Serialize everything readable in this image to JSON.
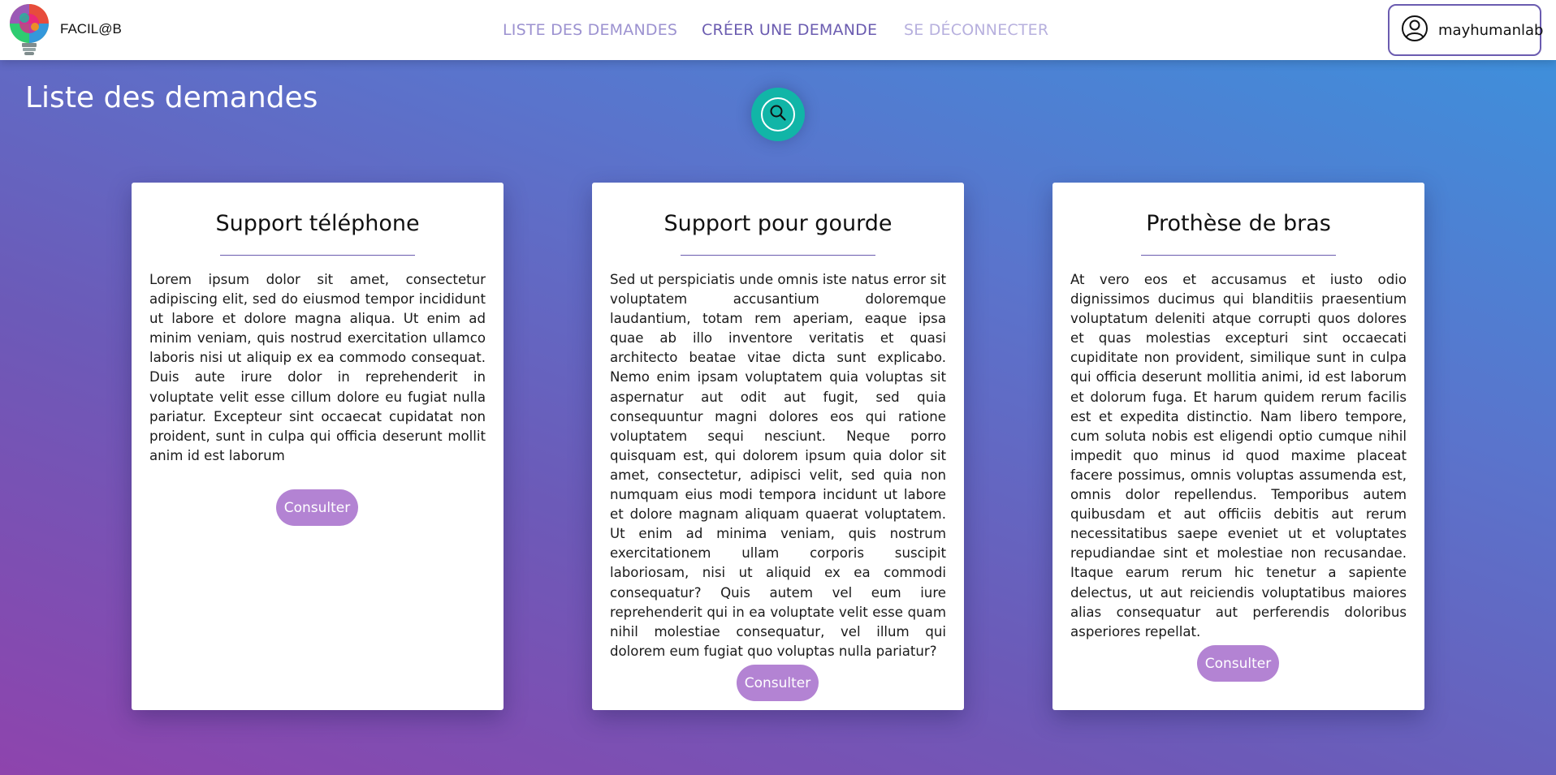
{
  "header": {
    "brand": "FACIL@B",
    "nav": [
      {
        "label": "LISTE DES DEMANDES"
      },
      {
        "label": "CRÉER UNE DEMANDE"
      },
      {
        "label": "SE DÉCONNECTER"
      }
    ],
    "user": {
      "name": "mayhumanlab",
      "icon": "user-circle-icon"
    }
  },
  "main": {
    "title": "Liste des demandes",
    "search_icon": "search-icon",
    "cards": [
      {
        "title": "Support téléphone",
        "text": "Lorem ipsum dolor sit amet, consectetur adipiscing elit, sed do eiusmod tempor incididunt ut labore et dolore magna aliqua. Ut enim ad minim veniam, quis nostrud exercitation ullamco laboris nisi ut aliquip ex ea commodo consequat. Duis aute irure dolor in reprehenderit in voluptate velit esse cillum dolore eu fugiat nulla pariatur. Excepteur sint occaecat cupidatat non proident, sunt in culpa qui officia deserunt mollit anim id est laborum",
        "button": "Consulter"
      },
      {
        "title": "Support pour gourde",
        "text": "Sed ut perspiciatis unde omnis iste natus error sit voluptatem accusantium doloremque laudantium, totam rem aperiam, eaque ipsa quae ab illo inventore veritatis et quasi architecto beatae vitae dicta sunt explicabo. Nemo enim ipsam voluptatem quia voluptas sit aspernatur aut odit aut fugit, sed quia consequuntur magni dolores eos qui ratione voluptatem sequi nesciunt. Neque porro quisquam est, qui dolorem ipsum quia dolor sit amet, consectetur, adipisci velit, sed quia non numquam eius modi tempora incidunt ut labore et dolore magnam aliquam quaerat voluptatem. Ut enim ad minima veniam, quis nostrum exercitationem ullam corporis suscipit laboriosam, nisi ut aliquid ex ea commodi consequatur? Quis autem vel eum iure reprehenderit qui in ea voluptate velit esse quam nihil molestiae consequatur, vel illum qui dolorem eum fugiat quo voluptas nulla pariatur?",
        "button": "Consulter"
      },
      {
        "title": "Prothèse de bras",
        "text": "At vero eos et accusamus et iusto odio dignissimos ducimus qui blanditiis praesentium voluptatum deleniti atque corrupti quos dolores et quas molestias excepturi sint occaecati cupiditate non provident, similique sunt in culpa qui officia deserunt mollitia animi, id est laborum et dolorum fuga. Et harum quidem rerum facilis est et expedita distinctio. Nam libero tempore, cum soluta nobis est eligendi optio cumque nihil impedit quo minus id quod maxime placeat facere possimus, omnis voluptas assumenda est, omnis dolor repellendus. Temporibus autem quibusdam et aut officiis debitis aut rerum necessitatibus saepe eveniet ut et voluptates repudiandae sint et molestiae non recusandae. Itaque earum rerum hic tenetur a sapiente delectus, ut aut reiciendis voluptatibus maiores alias consequatur aut perferendis doloribus asperiores repellat.",
        "button": "Consulter"
      }
    ]
  },
  "colors": {
    "accent": "#6b5cb0",
    "button": "#b383d3",
    "search": "#11b5a7"
  }
}
